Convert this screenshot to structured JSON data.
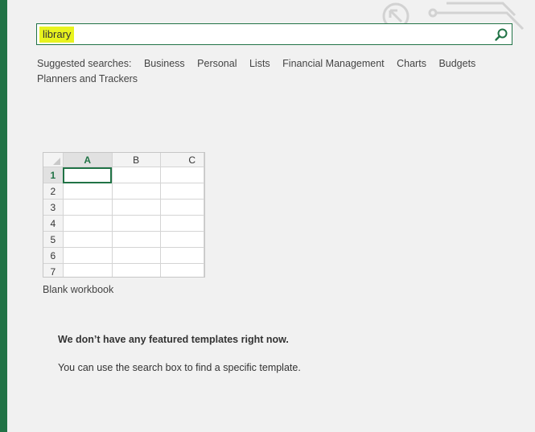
{
  "search": {
    "value": "library"
  },
  "suggested": {
    "label": "Suggested searches:",
    "items": [
      "Business",
      "Personal",
      "Lists",
      "Financial Management",
      "Charts",
      "Budgets",
      "Planners and Trackers"
    ]
  },
  "thumbnail": {
    "columns": [
      "A",
      "B",
      "C"
    ],
    "rows": [
      "1",
      "2",
      "3",
      "4",
      "5",
      "6",
      "7"
    ],
    "label": "Blank workbook"
  },
  "message": {
    "title": "We don’t have any featured templates right now.",
    "body": "You can use the search box to find a specific template."
  },
  "colors": {
    "accent": "#217346",
    "highlight": "#e8f31e"
  },
  "icons": {
    "search": "magnifier-icon"
  }
}
